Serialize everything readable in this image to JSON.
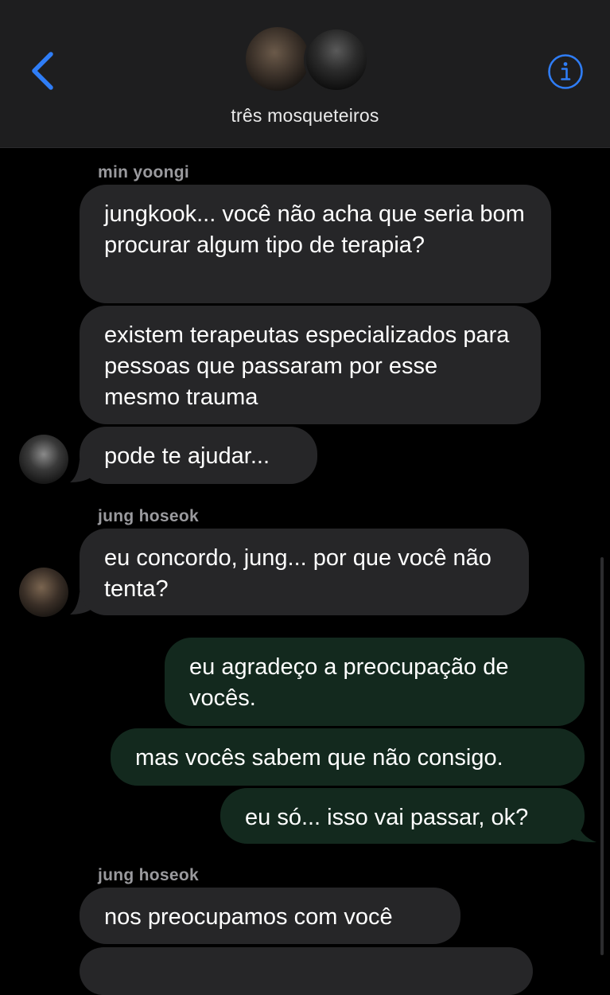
{
  "header": {
    "group_name": "três mosqueteiros"
  },
  "messages": [
    {
      "sender": "min yoongi"
    },
    {
      "text": "jungkook... você não acha que seria bom procurar algum tipo de terapia?"
    },
    {
      "text": "existem terapeutas especializados para pessoas que passaram por esse mesmo trauma"
    },
    {
      "text": "pode te ajudar..."
    },
    {
      "sender": "jung hoseok"
    },
    {
      "text": "eu concordo, jung... por que você não tenta?"
    },
    {
      "text": "eu agradeço a preocupação de vocês."
    },
    {
      "text": "mas vocês sabem que não consigo."
    },
    {
      "text": "eu só... isso vai passar, ok?"
    },
    {
      "sender": "jung hoseok"
    },
    {
      "text": "nos preocupamos com você"
    }
  ],
  "colors": {
    "accent": "#2f7df6",
    "incoming_bubble": "#262628",
    "outgoing_bubble": "#13291e",
    "header_bg": "#1e1e1f"
  }
}
